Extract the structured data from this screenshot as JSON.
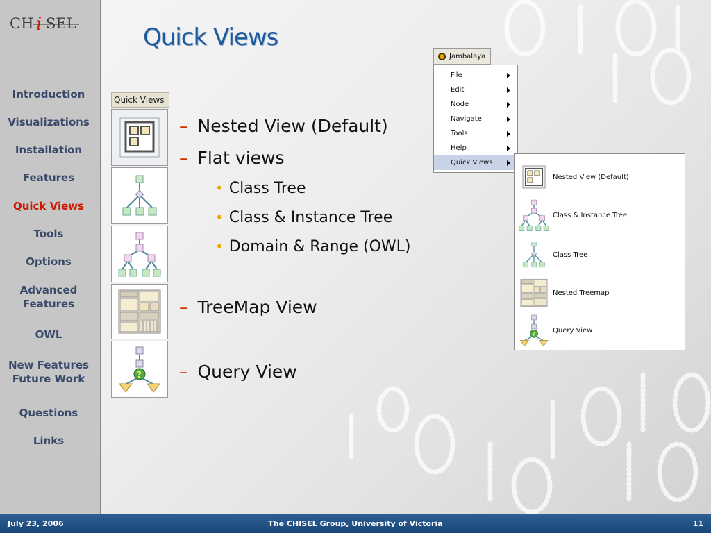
{
  "logo": {
    "text_left": "CH",
    "text_i": "i",
    "text_right": "SEL"
  },
  "sidebar": {
    "items": [
      {
        "label": "Introduction",
        "active": false
      },
      {
        "label": "Visualizations",
        "active": false
      },
      {
        "label": "Installation",
        "active": false
      },
      {
        "label": "Features",
        "active": false
      },
      {
        "label": "Quick Views",
        "active": true
      },
      {
        "label": "Tools",
        "active": false
      },
      {
        "label": "Options",
        "active": false
      },
      {
        "label": "Advanced\nFeatures",
        "active": false
      },
      {
        "label": "OWL",
        "active": false
      },
      {
        "label": "New Features\nFuture Work",
        "active": false
      },
      {
        "label": "Questions",
        "active": false
      },
      {
        "label": "Links",
        "active": false
      }
    ]
  },
  "slide": {
    "title": "Quick Views",
    "strip_header": "Quick Views",
    "bullets": {
      "b1": "Nested View (Default)",
      "b2": "Flat views",
      "b2a": "Class Tree",
      "b2b": "Class & Instance Tree",
      "b2c": "Domain & Range (OWL)",
      "b3": "TreeMap View",
      "b4": "Query View"
    }
  },
  "menu": {
    "title": "Jambalaya",
    "items": [
      "File",
      "Edit",
      "Node",
      "Navigate",
      "Tools",
      "Help",
      "Quick Views"
    ],
    "selected": "Quick Views",
    "submenu": [
      "Nested View (Default)",
      "Class & Instance Tree",
      "Class Tree",
      "Nested Treemap",
      "Query View"
    ]
  },
  "footer": {
    "date": "July 23, 2006",
    "org": "The CHISEL Group, University of Victoria",
    "page": "11"
  },
  "colors": {
    "title": "#1e5a9e",
    "active_nav": "#cc1a00",
    "nav": "#3a4a6a",
    "dash": "#cc3300",
    "dot": "#e8a800",
    "footer": "#1f4c7f"
  }
}
